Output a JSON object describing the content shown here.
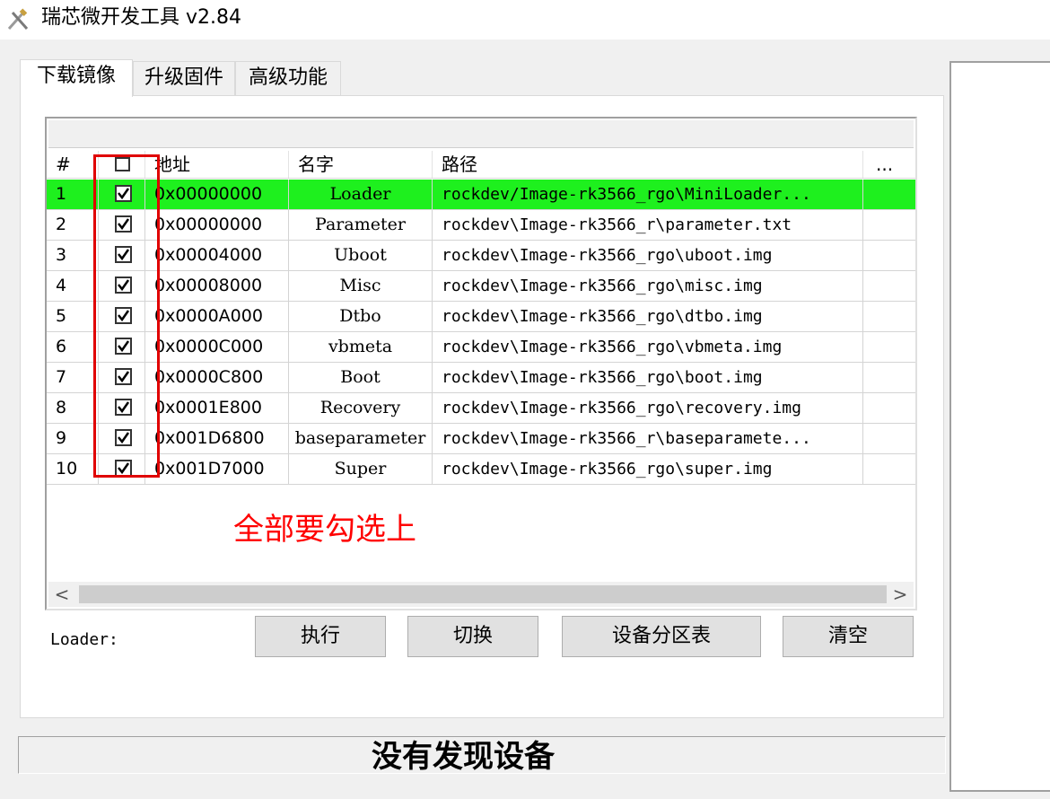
{
  "window": {
    "title": "瑞芯微开发工具 v2.84",
    "icon": "tools-icon"
  },
  "tabs": [
    {
      "label": "下载镜像",
      "active": true
    },
    {
      "label": "升级固件",
      "active": false
    },
    {
      "label": "高级功能",
      "active": false
    }
  ],
  "table": {
    "headers": {
      "num": "#",
      "address": "地址",
      "name": "名字",
      "path": "路径",
      "more": "..."
    },
    "header_checkbox_checked": false,
    "rows": [
      {
        "num": "1",
        "checked": true,
        "address": "0x00000000",
        "name": "Loader",
        "path": "rockdev/Image-rk3566_rgo\\MiniLoader...",
        "selected": true
      },
      {
        "num": "2",
        "checked": true,
        "address": "0x00000000",
        "name": "Parameter",
        "path": "rockdev\\Image-rk3566_r\\parameter.txt",
        "selected": false
      },
      {
        "num": "3",
        "checked": true,
        "address": "0x00004000",
        "name": "Uboot",
        "path": "rockdev\\Image-rk3566_rgo\\uboot.img",
        "selected": false
      },
      {
        "num": "4",
        "checked": true,
        "address": "0x00008000",
        "name": "Misc",
        "path": "rockdev\\Image-rk3566_rgo\\misc.img",
        "selected": false
      },
      {
        "num": "5",
        "checked": true,
        "address": "0x0000A000",
        "name": "Dtbo",
        "path": "rockdev\\Image-rk3566_rgo\\dtbo.img",
        "selected": false
      },
      {
        "num": "6",
        "checked": true,
        "address": "0x0000C000",
        "name": "vbmeta",
        "path": "rockdev\\Image-rk3566_rgo\\vbmeta.img",
        "selected": false
      },
      {
        "num": "7",
        "checked": true,
        "address": "0x0000C800",
        "name": "Boot",
        "path": "rockdev\\Image-rk3566_rgo\\boot.img",
        "selected": false
      },
      {
        "num": "8",
        "checked": true,
        "address": "0x0001E800",
        "name": "Recovery",
        "path": "rockdev\\Image-rk3566_rgo\\recovery.img",
        "selected": false
      },
      {
        "num": "9",
        "checked": true,
        "address": "0x001D6800",
        "name": "baseparameter",
        "path": "rockdev\\Image-rk3566_r\\baseparamete...",
        "selected": false
      },
      {
        "num": "10",
        "checked": true,
        "address": "0x001D7000",
        "name": "Super",
        "path": "rockdev\\Image-rk3566_rgo\\super.img",
        "selected": false
      }
    ]
  },
  "scrollbar": {
    "left_arrow": "<",
    "right_arrow": ">"
  },
  "annotation": {
    "text": "全部要勾选上",
    "color": "#ff0000"
  },
  "loader_label": "Loader:",
  "buttons": {
    "execute": "执行",
    "switch": "切换",
    "partition_table": "设备分区表",
    "clear": "清空"
  },
  "status": "没有发现设备",
  "colors": {
    "selected_row": "#1ef01e",
    "highlight_box": "#e00000"
  }
}
